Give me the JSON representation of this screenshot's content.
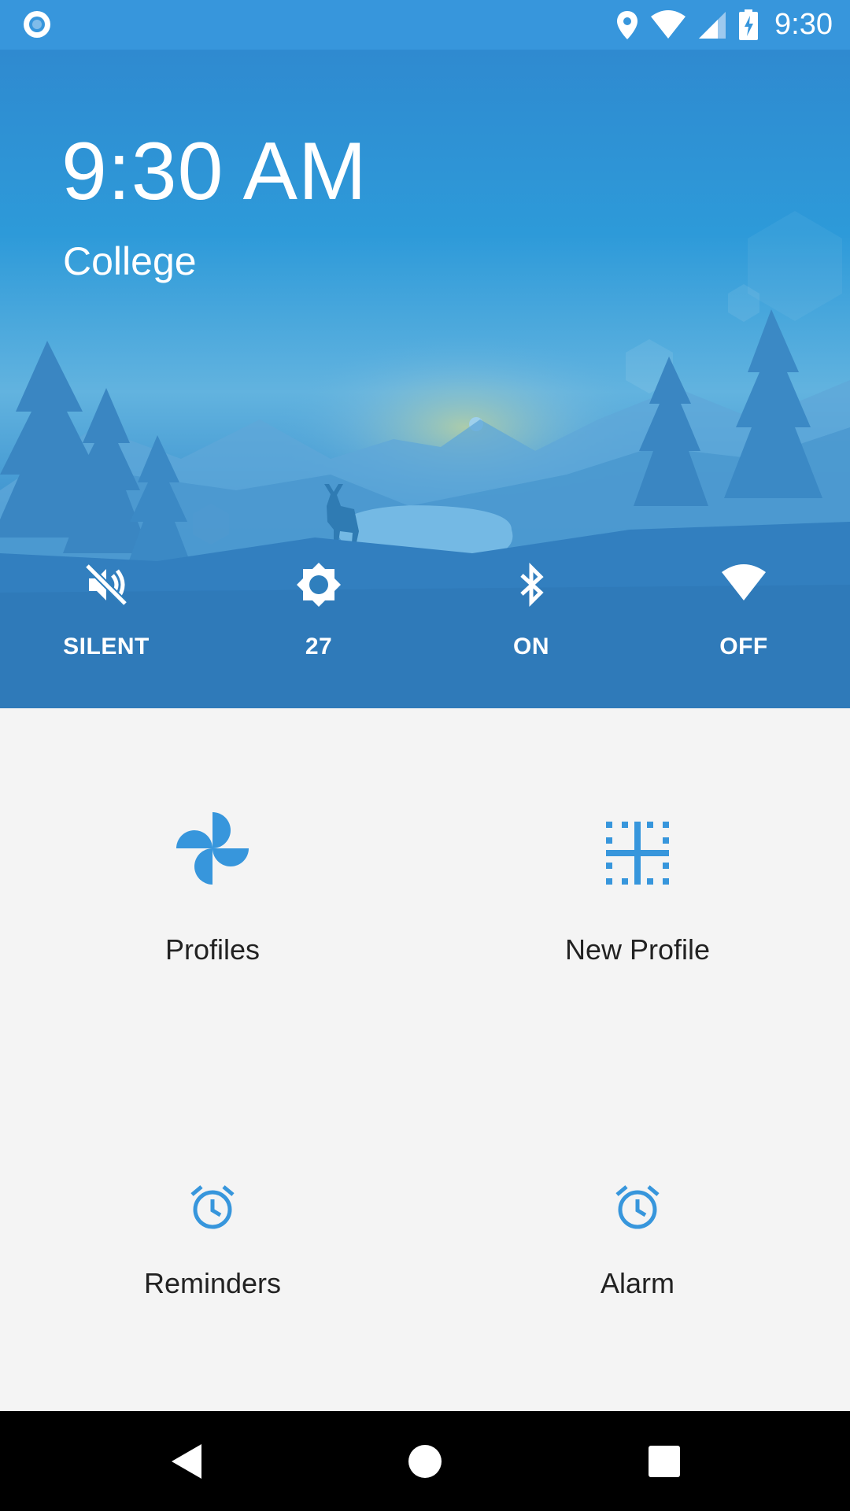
{
  "status_bar": {
    "time": "9:30",
    "icons": [
      "app-status-icon",
      "location-icon",
      "wifi-icon",
      "cell-signal-icon",
      "battery-charging-icon"
    ]
  },
  "hero": {
    "clock": "9:30 AM",
    "profile_name": "College"
  },
  "quick_settings": [
    {
      "icon": "volume-off-icon",
      "label": "SILENT"
    },
    {
      "icon": "brightness-icon",
      "label": "27"
    },
    {
      "icon": "bluetooth-icon",
      "label": "ON"
    },
    {
      "icon": "wifi-icon",
      "label": "OFF"
    }
  ],
  "menu": [
    {
      "icon": "pinwheel-icon",
      "label": "Profiles"
    },
    {
      "icon": "new-profile-grid-icon",
      "label": "New Profile"
    },
    {
      "icon": "alarm-clock-icon",
      "label": "Reminders"
    },
    {
      "icon": "alarm-clock-icon",
      "label": "Alarm"
    }
  ],
  "colors": {
    "accent": "#3796dc",
    "hero_top": "#2f8ad0",
    "background": "#f4f4f4",
    "navbar": "#000000"
  },
  "nav_bar": [
    "back-icon",
    "home-icon",
    "recents-icon"
  ]
}
